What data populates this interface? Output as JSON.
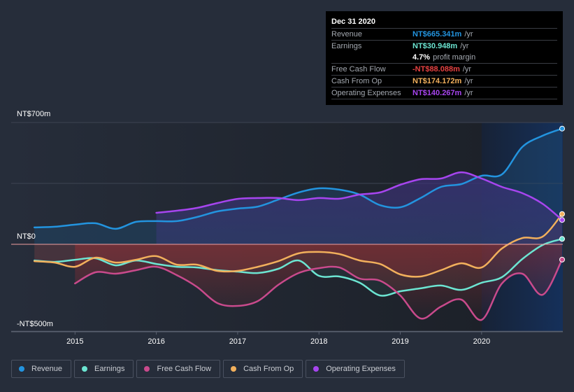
{
  "tooltip": {
    "date": "Dec 31 2020",
    "rows": [
      {
        "label": "Revenue",
        "value": "NT$665.341m",
        "unit": "/yr",
        "color": "#2394df"
      },
      {
        "label": "Earnings",
        "value": "NT$30.948m",
        "unit": "/yr",
        "color": "#6ce5d2"
      },
      {
        "label": "",
        "value": "4.7%",
        "unit": "profit margin",
        "color": "#ffffff"
      },
      {
        "label": "Free Cash Flow",
        "value": "-NT$88.088m",
        "unit": "/yr",
        "color": "#e64141"
      },
      {
        "label": "Cash From Op",
        "value": "NT$174.172m",
        "unit": "/yr",
        "color": "#f2b05c"
      },
      {
        "label": "Operating Expenses",
        "value": "NT$140.267m",
        "unit": "/yr",
        "color": "#a745ef"
      }
    ]
  },
  "legend": [
    {
      "label": "Revenue",
      "color": "#2394df"
    },
    {
      "label": "Earnings",
      "color": "#6ce5d2"
    },
    {
      "label": "Free Cash Flow",
      "color": "#c94a8c"
    },
    {
      "label": "Cash From Op",
      "color": "#f2b05c"
    },
    {
      "label": "Operating Expenses",
      "color": "#a745ef"
    }
  ],
  "chart_data": {
    "type": "line",
    "title": "",
    "xlabel": "",
    "ylabel": "",
    "y_tick_labels": [
      "NT$700m",
      "NT$0",
      "-NT$500m"
    ],
    "y_ticks": [
      700,
      0,
      -500
    ],
    "ylim": [
      -500,
      700
    ],
    "xlim": [
      2014.49,
      2020.99
    ],
    "x_tick_labels": [
      "2015",
      "2016",
      "2017",
      "2018",
      "2019",
      "2020"
    ],
    "x_ticks": [
      2015,
      2016,
      2017,
      2018,
      2019,
      2020
    ],
    "grid": true,
    "legend_position": "bottom-left",
    "highlight_from": 2020,
    "x": [
      2014.5,
      2014.75,
      2015.0,
      2015.25,
      2015.5,
      2015.75,
      2016.0,
      2016.25,
      2016.5,
      2016.75,
      2017.0,
      2017.25,
      2017.5,
      2017.75,
      2018.0,
      2018.25,
      2018.5,
      2018.75,
      2019.0,
      2019.25,
      2019.5,
      2019.75,
      2020.0,
      2020.25,
      2020.5,
      2020.75,
      2020.99
    ],
    "series": [
      {
        "name": "Revenue",
        "color": "#2394df",
        "values": [
          97,
          101,
          113,
          121,
          89,
          129,
          133,
          133,
          157,
          189,
          205,
          217,
          257,
          298,
          322,
          314,
          286,
          225,
          213,
          266,
          330,
          346,
          394,
          402,
          559,
          624,
          665
        ]
      },
      {
        "name": "Earnings",
        "color": "#6ce5d2",
        "values": [
          -93,
          -101,
          -89,
          -80,
          -121,
          -93,
          -113,
          -129,
          -133,
          -149,
          -157,
          -165,
          -141,
          -93,
          -181,
          -185,
          -221,
          -294,
          -270,
          -253,
          -237,
          -262,
          -221,
          -189,
          -85,
          -4,
          31
        ]
      },
      {
        "name": "Free Cash Flow",
        "color": "#c94a8c",
        "values": [
          null,
          null,
          -225,
          -161,
          -169,
          -149,
          -129,
          -177,
          -245,
          -338,
          -354,
          -326,
          -233,
          -165,
          -137,
          -133,
          -197,
          -209,
          -294,
          -426,
          -358,
          -318,
          -434,
          -225,
          -169,
          -290,
          -88
        ]
      },
      {
        "name": "Cash From Op",
        "color": "#f2b05c",
        "values": [
          -97,
          -105,
          -129,
          -77,
          -105,
          -89,
          -68,
          -117,
          -117,
          -153,
          -153,
          -129,
          -97,
          -52,
          -44,
          -56,
          -93,
          -113,
          -173,
          -185,
          -149,
          -109,
          -133,
          -24,
          36,
          44,
          174
        ]
      },
      {
        "name": "Operating Expenses",
        "color": "#a745ef",
        "values": [
          null,
          null,
          null,
          null,
          null,
          null,
          181,
          193,
          209,
          237,
          261,
          266,
          266,
          254,
          266,
          262,
          286,
          298,
          342,
          374,
          378,
          414,
          378,
          330,
          294,
          233,
          140
        ]
      }
    ]
  }
}
